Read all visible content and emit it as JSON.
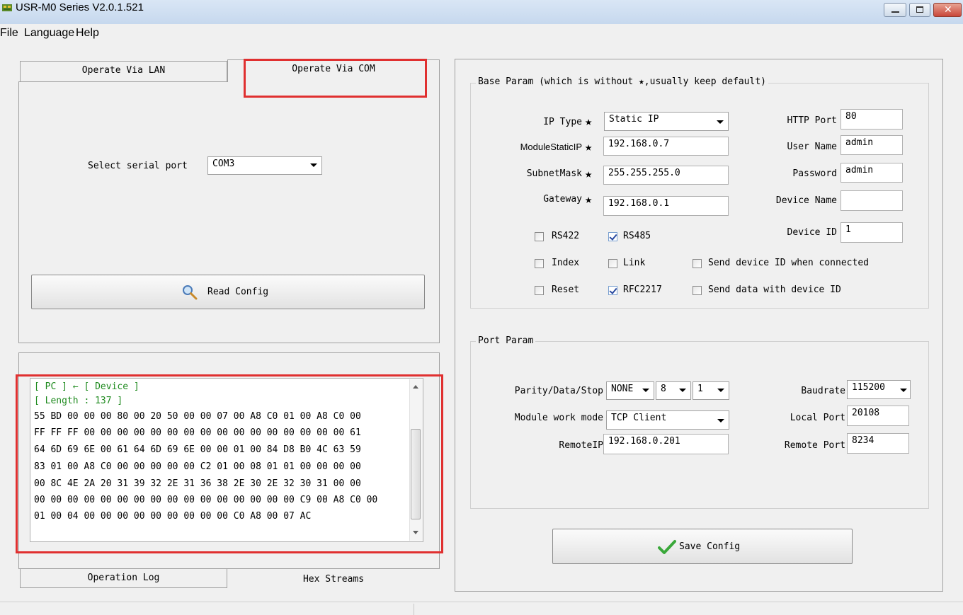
{
  "window": {
    "title": "USR-M0 Series V2.0.1.521"
  },
  "menu": {
    "items": [
      "File",
      "Language",
      "Help"
    ]
  },
  "tabs_top": {
    "lan": "Operate Via LAN",
    "com": "Operate Via COM"
  },
  "com_panel": {
    "serial_label": "Select serial port",
    "serial_value": "COM3",
    "read_config": "Read Config"
  },
  "log": {
    "lines_green": [
      "[ PC ] ← [ Device ]",
      "[ Length : 137 ]"
    ],
    "hex_lines": [
      "55 BD 00 00 00 80 00 20 50 00 00 07 00 A8 C0 01 00 A8 C0 00",
      "FF FF FF 00 00 00 00 00 00 00 00 00 00 00 00 00 00 00 00 61",
      "64 6D 69 6E 00 61 64 6D 69 6E 00 00 01 00 84 D8 B0 4C 63 59",
      "83 01 00 A8 C0 00 00 00 00 00 C2 01 00 08 01 01 00 00 00 00",
      "00 8C 4E 2A 20 31 39 32 2E 31 36 38 2E 30 2E 32 30 31 00 00",
      "00 00 00 00 00 00 00 00 00 00 00 00 00 00 00 00 C9 00 A8 C0 00",
      "01 00 04 00 00 00 00 00 00 00 00 00 C0 A8 00 07 AC"
    ]
  },
  "tabs_bottom": {
    "log": "Operation Log",
    "hex": "Hex Streams"
  },
  "base_param": {
    "title": "Base Param (which is without ★,usually keep default)",
    "star": "★",
    "ip_type_label": "IP Type",
    "ip_type_value": "Static IP",
    "module_ip_label": "ModuleStaticIP",
    "module_ip_value": "192.168.0.7",
    "subnet_label": "SubnetMask",
    "subnet_value": "255.255.255.0",
    "gateway_label": "Gateway",
    "gateway_value": "192.168.0.1",
    "http_port_label": "HTTP Port",
    "http_port_value": "80",
    "user_name_label": "User Name",
    "user_name_value": "admin",
    "password_label": "Password",
    "password_value": "admin",
    "device_name_label": "Device Name",
    "device_name_value": "",
    "device_id_label": "Device ID",
    "device_id_value": "1",
    "checkboxes": {
      "rs422": {
        "label": "RS422",
        "checked": false
      },
      "rs485": {
        "label": "RS485",
        "checked": true
      },
      "index": {
        "label": "Index",
        "checked": false
      },
      "link": {
        "label": "Link",
        "checked": false
      },
      "send_id_connected": {
        "label": "Send device ID when connected",
        "checked": false
      },
      "reset": {
        "label": "Reset",
        "checked": false
      },
      "rfc2217": {
        "label": "RFC2217",
        "checked": true
      },
      "send_data_with_id": {
        "label": "Send data with device ID",
        "checked": false
      }
    }
  },
  "port_param": {
    "title": "Port Param",
    "parity_label": "Parity/Data/Stop",
    "parity_value": "NONE",
    "data_value": "8",
    "stop_value": "1",
    "baudrate_label": "Baudrate",
    "baudrate_value": "115200",
    "work_mode_label": "Module work mode",
    "work_mode_value": "TCP Client",
    "local_port_label": "Local Port",
    "local_port_value": "20108",
    "remote_ip_label": "RemoteIP",
    "remote_ip_value": "192.168.0.201",
    "remote_port_label": "Remote Port",
    "remote_port_value": "8234"
  },
  "save_config": "Save Config"
}
